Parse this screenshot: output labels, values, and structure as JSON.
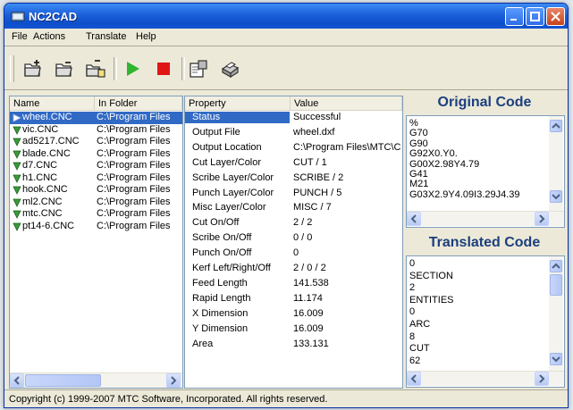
{
  "window": {
    "title": "NC2CAD"
  },
  "menu": [
    "File",
    "Actions",
    "Translate",
    "Help"
  ],
  "toolbar": {
    "icons": [
      "open-file-icon",
      "open-folder-icon",
      "batch-open-icon",
      "run-icon",
      "stop-icon",
      "settings-icon",
      "print-icon"
    ]
  },
  "files": {
    "headers": {
      "name": "Name",
      "folder": "In Folder"
    },
    "rows": [
      {
        "name": "wheel.CNC",
        "folder": "C:\\Program Files"
      },
      {
        "name": "vic.CNC",
        "folder": "C:\\Program Files"
      },
      {
        "name": "ad5217.CNC",
        "folder": "C:\\Program Files"
      },
      {
        "name": "blade.CNC",
        "folder": "C:\\Program Files"
      },
      {
        "name": "d7.CNC",
        "folder": "C:\\Program Files"
      },
      {
        "name": "h1.CNC",
        "folder": "C:\\Program Files"
      },
      {
        "name": "hook.CNC",
        "folder": "C:\\Program Files"
      },
      {
        "name": "ml2.CNC",
        "folder": "C:\\Program Files"
      },
      {
        "name": "mtc.CNC",
        "folder": "C:\\Program Files"
      },
      {
        "name": "pt14-6.CNC",
        "folder": "C:\\Program Files"
      }
    ]
  },
  "properties": {
    "headers": {
      "property": "Property",
      "value": "Value"
    },
    "rows": [
      {
        "property": "Status",
        "value": "Successful"
      },
      {
        "property": "Output File",
        "value": "wheel.dxf"
      },
      {
        "property": "Output Location",
        "value": "C:\\Program Files\\MTC\\C"
      },
      {
        "property": "Cut Layer/Color",
        "value": "CUT / 1"
      },
      {
        "property": "Scribe Layer/Color",
        "value": "SCRIBE / 2"
      },
      {
        "property": "Punch Layer/Color",
        "value": "PUNCH / 5"
      },
      {
        "property": "Misc Layer/Color",
        "value": "MISC / 7"
      },
      {
        "property": "Cut On/Off",
        "value": "2 / 2"
      },
      {
        "property": "Scribe On/Off",
        "value": "0 / 0"
      },
      {
        "property": "Punch On/Off",
        "value": "0"
      },
      {
        "property": "Kerf Left/Right/Off",
        "value": "2 / 0 / 2"
      },
      {
        "property": "Feed Length",
        "value": "141.538"
      },
      {
        "property": "Rapid Length",
        "value": "11.174"
      },
      {
        "property": "X Dimension",
        "value": "16.009"
      },
      {
        "property": "Y Dimension",
        "value": "16.009"
      },
      {
        "property": "Area",
        "value": "133.131"
      }
    ]
  },
  "original_code": {
    "title": "Original Code",
    "lines": [
      "%",
      "G70",
      "G90",
      "G92X0.Y0.",
      "G00X2.98Y4.79",
      "G41",
      "M21",
      "G03X2.9Y4.09I3.29J4.39"
    ]
  },
  "translated_code": {
    "title": "Translated Code",
    "lines": [
      " 0",
      "SECTION",
      " 2",
      "ENTITIES",
      " 0",
      "ARC",
      " 8",
      "CUT",
      " 62"
    ]
  },
  "status_text": "Copyright (c) 1999-2007 MTC Software, Incorporated.  All rights reserved.",
  "colors": {
    "selection": "#316ac5",
    "header_blue": "#1c3f7e",
    "titlebar": "#0e4ecb",
    "run": "#2fb52f",
    "stop": "#e01515"
  }
}
